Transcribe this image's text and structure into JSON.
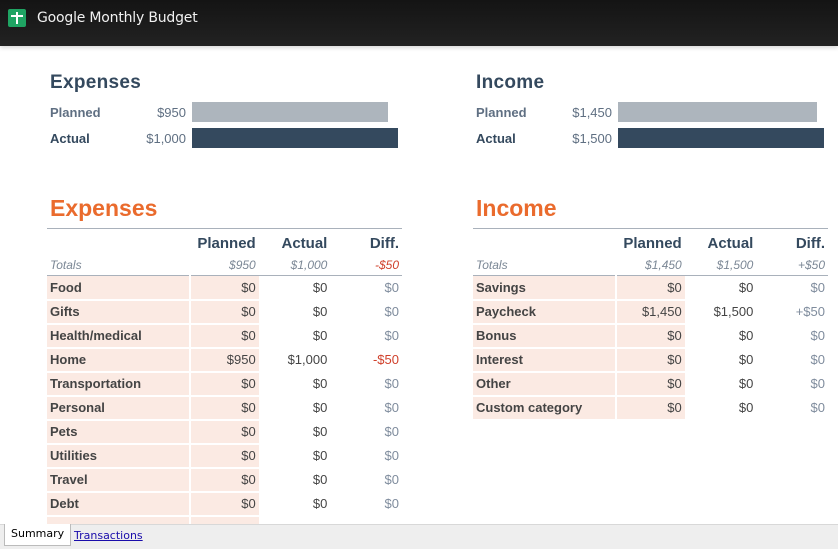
{
  "window": {
    "title": "Google Monthly Budget",
    "icon": "google-sheets-icon"
  },
  "summary": {
    "expenses": {
      "heading": "Expenses",
      "planned_label": "Planned",
      "planned_value": "$950",
      "planned_amount": 950,
      "actual_label": "Actual",
      "actual_value": "$1,000",
      "actual_amount": 1000
    },
    "income": {
      "heading": "Income",
      "planned_label": "Planned",
      "planned_value": "$1,450",
      "planned_amount": 1450,
      "actual_label": "Actual",
      "actual_value": "$1,500",
      "actual_amount": 1500
    }
  },
  "expenses_table": {
    "title": "Expenses",
    "columns": [
      "Planned",
      "Actual",
      "Diff."
    ],
    "totals": {
      "label": "Totals",
      "planned": "$950",
      "actual": "$1,000",
      "diff": "-$50"
    },
    "rows": [
      {
        "category": "Food",
        "planned": "$0",
        "actual": "$0",
        "diff": "$0"
      },
      {
        "category": "Gifts",
        "planned": "$0",
        "actual": "$0",
        "diff": "$0"
      },
      {
        "category": "Health/medical",
        "planned": "$0",
        "actual": "$0",
        "diff": "$0"
      },
      {
        "category": "Home",
        "planned": "$950",
        "actual": "$1,000",
        "diff": "-$50"
      },
      {
        "category": "Transportation",
        "planned": "$0",
        "actual": "$0",
        "diff": "$0"
      },
      {
        "category": "Personal",
        "planned": "$0",
        "actual": "$0",
        "diff": "$0"
      },
      {
        "category": "Pets",
        "planned": "$0",
        "actual": "$0",
        "diff": "$0"
      },
      {
        "category": "Utilities",
        "planned": "$0",
        "actual": "$0",
        "diff": "$0"
      },
      {
        "category": "Travel",
        "planned": "$0",
        "actual": "$0",
        "diff": "$0"
      },
      {
        "category": "Debt",
        "planned": "$0",
        "actual": "$0",
        "diff": "$0"
      }
    ]
  },
  "income_table": {
    "title": "Income",
    "columns": [
      "Planned",
      "Actual",
      "Diff."
    ],
    "totals": {
      "label": "Totals",
      "planned": "$1,450",
      "actual": "$1,500",
      "diff": "+$50"
    },
    "rows": [
      {
        "category": "Savings",
        "planned": "$0",
        "actual": "$0",
        "diff": "$0"
      },
      {
        "category": "Paycheck",
        "planned": "$1,450",
        "actual": "$1,500",
        "diff": "+$50"
      },
      {
        "category": "Bonus",
        "planned": "$0",
        "actual": "$0",
        "diff": "$0"
      },
      {
        "category": "Interest",
        "planned": "$0",
        "actual": "$0",
        "diff": "$0"
      },
      {
        "category": "Other",
        "planned": "$0",
        "actual": "$0",
        "diff": "$0"
      },
      {
        "category": "Custom category",
        "planned": "$0",
        "actual": "$0",
        "diff": "$0"
      }
    ]
  },
  "sheet_tabs": {
    "active": "Summary",
    "other": "Transactions"
  },
  "colors": {
    "accent_orange": "#ea6b2d",
    "navy": "#34495e",
    "planned_bar": "#adb5bd",
    "negative_red": "#d0402b",
    "category_fill": "#fbeae3"
  }
}
